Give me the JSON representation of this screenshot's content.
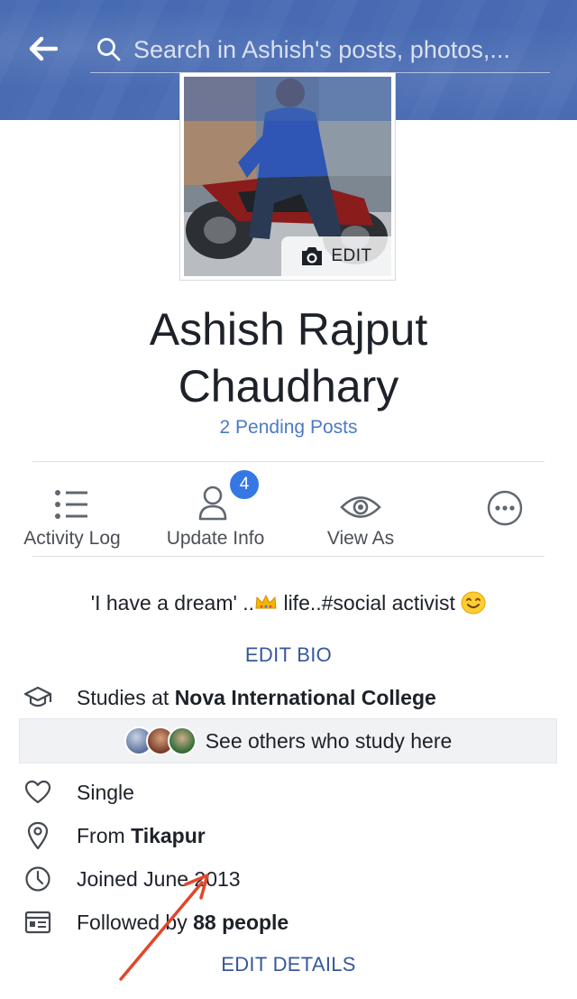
{
  "header": {
    "search_placeholder": "Search in Ashish's posts, photos,..."
  },
  "profile_photo": {
    "edit_label": "EDIT"
  },
  "profile": {
    "name": "Ashish Rajput\nChaudhary",
    "pending_posts": "2 Pending Posts"
  },
  "actions": {
    "activity_log": "Activity Log",
    "update_info": "Update Info",
    "update_info_badge": "4",
    "view_as": "View As"
  },
  "bio": {
    "text_part1": "'I have a dream' ..",
    "text_part2": " life..#social activist ",
    "edit_label": "EDIT BIO"
  },
  "details": {
    "studies_prefix": "Studies at ",
    "studies_school": "Nova International College",
    "see_others": "See others who study here",
    "relationship": "Single",
    "from_prefix": "From ",
    "from_place": "Tikapur",
    "joined": "Joined June 2013",
    "followed_prefix": "Followed by ",
    "followed_count": "88 people",
    "edit_label": "EDIT DETAILS"
  },
  "colors": {
    "facebook_blue": "#4267b2",
    "link_blue": "#4b7bc5",
    "edit_blue": "#365899",
    "badge_blue": "#3578e5",
    "annotation_red": "#e0472a"
  },
  "icons": {
    "back": "arrow-left-icon",
    "search": "search-icon",
    "camera": "camera-icon",
    "activity_log": "list-icon",
    "update_info": "person-icon",
    "view_as": "eye-icon",
    "more": "more-dots-icon",
    "studies": "graduation-cap-icon",
    "relationship": "heart-icon",
    "from": "location-pin-icon",
    "joined": "clock-icon",
    "followed": "rss-card-icon"
  }
}
